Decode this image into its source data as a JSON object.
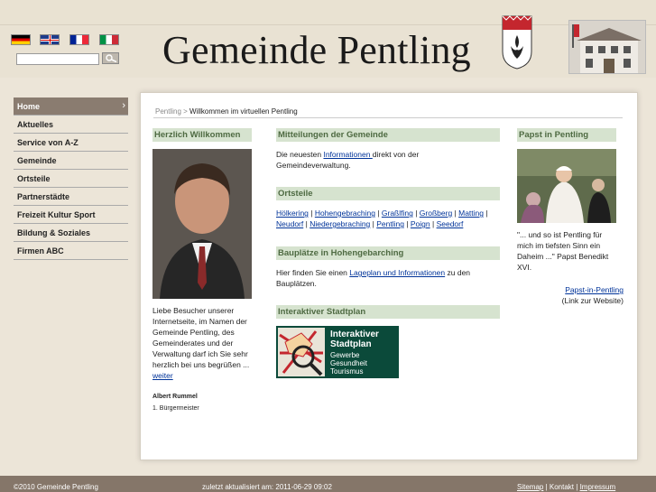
{
  "header": {
    "title": "Gemeinde Pentling",
    "flags": [
      "flag-germany-icon",
      "flag-uk-icon",
      "flag-france-icon",
      "flag-italy-icon"
    ],
    "search": {
      "value": "",
      "placeholder": ""
    }
  },
  "nav": {
    "items": [
      {
        "label": "Home",
        "active": true
      },
      {
        "label": "Aktuelles"
      },
      {
        "label": "Service von A-Z"
      },
      {
        "label": "Gemeinde"
      },
      {
        "label": "Ortsteile"
      },
      {
        "label": "Partnerstädte"
      },
      {
        "label": "Freizeit Kultur Sport"
      },
      {
        "label": "Bildung & Soziales"
      },
      {
        "label": "Firmen ABC"
      }
    ],
    "chevron": "›"
  },
  "breadcrumb": {
    "root": "Pentling",
    "sep": " > ",
    "current": "Willkommen im virtuellen Pentling"
  },
  "welcome": {
    "heading": "Herzlich Willkommen",
    "text": "Liebe Besucher unserer Internetseite, im Namen der Gemeinde Pentling, des Gemeinderates und der Verwaltung darf ich Sie sehr herzlich bei uns begrüßen ...",
    "more": "weiter",
    "signature_name": "Albert Rummel",
    "signature_role": "1. Bürgermeister"
  },
  "mitteilungen": {
    "heading": "Mitteilungen der Gemeinde",
    "pre": "Die neuesten ",
    "link": "Informationen ",
    "post": "direkt von der Gemeindeverwaltung."
  },
  "ortsteile": {
    "heading": "Ortsteile",
    "links": [
      "Hölkering",
      "Hohengebraching",
      "Graßlfing",
      "Großberg",
      "Matting",
      "Neudorf",
      "Niedergebraching",
      "Pentling",
      "Poign",
      "Seedorf"
    ],
    "sep": " | "
  },
  "bauplaetze": {
    "heading": "Bauplätze in Hohengebarching",
    "pre": "Hier finden Sie einen ",
    "link": "Lageplan und Informationen",
    "post": " zu den Bauplätzen."
  },
  "stadtplan": {
    "heading": "Interaktiver Stadtplan",
    "image_title": "Interaktiver Stadtplan",
    "image_sub": "Gewerbe Gesundheit Tourismus"
  },
  "papst": {
    "heading": "Papst in Pentling",
    "quote": "\"... und so ist Pentling für mich im tiefsten Sinn ein Daheim ...\"  Papst Benedikt XVI.",
    "link": "Papst-in-Pentling",
    "link_note": "(Link zur Website)"
  },
  "footer": {
    "copyright": "©2010 Gemeinde Pentling",
    "updated": "zuletzt aktualisiert am: 2011-06-29 09:02",
    "links": [
      "Sitemap",
      "Kontakt",
      "Impressum"
    ]
  },
  "colors": {
    "nav_active": "#8a7c70",
    "heading_bg": "#d6e3cf",
    "heading_text": "#4e6a42",
    "link": "#003399",
    "footer_bg": "#857669"
  }
}
